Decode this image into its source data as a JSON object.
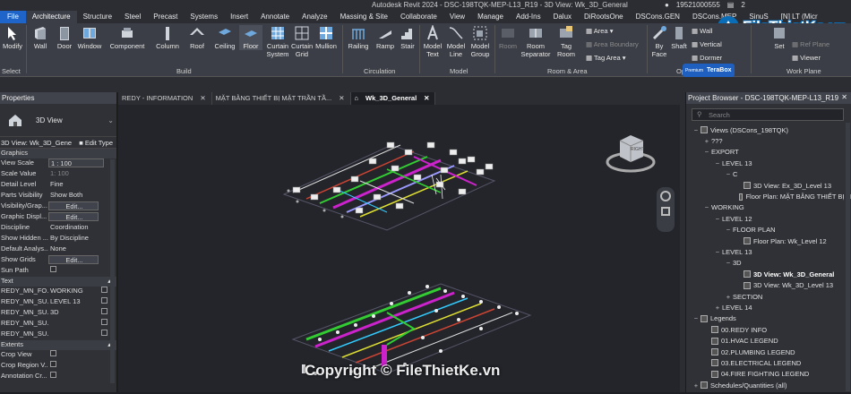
{
  "window": {
    "title": "Autodesk Revit 2024 - DSC-198TQK-MEP-L13_R19 - 3D View: Wk_3D_General",
    "user": "19521000555",
    "zoom_marker": "2"
  },
  "menu": [
    "File",
    "Architecture",
    "Structure",
    "Steel",
    "Precast",
    "Systems",
    "Insert",
    "Annotate",
    "Analyze",
    "Massing & Site",
    "Collaborate",
    "View",
    "Manage",
    "Add-Ins",
    "Dalux",
    "DiRootsOne",
    "DSCons.GEN",
    "DSCons.MEP",
    "SinuS",
    "[N] LT (Micr"
  ],
  "ribbon": {
    "buttons": [
      "Modify",
      "Wall",
      "Door",
      "Window",
      "Component",
      "Column",
      "Roof",
      "Ceiling",
      "Floor",
      "Curtain System",
      "Curtain Grid",
      "Mullion",
      "Railing",
      "Ramp",
      "Stair",
      "Model Text",
      "Model Line",
      "Model Group",
      "Room",
      "Room Separator",
      "Tag Room",
      "By Face",
      "Shaft",
      "Set",
      "Viewer"
    ],
    "small": {
      "area": "Area",
      "area_boundary": "Area Boundary",
      "tag_area": "Tag Area",
      "wall": "Wall",
      "vertical": "Vertical",
      "dormer": "Dormer",
      "ref_plane": "Ref Plane"
    },
    "groups": [
      "Select",
      "Build",
      "Circulation",
      "Model",
      "Room & Area",
      "Ope",
      "Work Plane"
    ],
    "terabox": "TeraBox",
    "premium": "Premium"
  },
  "properties": {
    "title": "Properties",
    "type_name": "3D View",
    "view_selector": "3D View: Wk_3D_Gene",
    "edit_type": "Edit Type",
    "sections": {
      "graphics": "Graphics",
      "text": "Text",
      "extents": "Extents"
    },
    "graphics_rows": [
      {
        "k": "View Scale",
        "v": "1 : 100",
        "style": "box"
      },
      {
        "k": "Scale Value",
        "v": "1: 100",
        "style": "dim"
      },
      {
        "k": "Detail Level",
        "v": "Fine",
        "style": ""
      },
      {
        "k": "Parts Visibility",
        "v": "Show Both",
        "style": ""
      },
      {
        "k": "Visibility/Grap...",
        "v": "Edit...",
        "style": "btn"
      },
      {
        "k": "Graphic Displ...",
        "v": "Edit...",
        "style": "btn"
      },
      {
        "k": "Discipline",
        "v": "Coordination",
        "style": ""
      },
      {
        "k": "Show Hidden ...",
        "v": "By Discipline",
        "style": ""
      },
      {
        "k": "Default Analys...",
        "v": "None",
        "style": ""
      },
      {
        "k": "Show Grids",
        "v": "Edit...",
        "style": "btn"
      },
      {
        "k": "Sun Path",
        "v": "",
        "style": "check"
      }
    ],
    "text_rows": [
      {
        "k": "REDY_MN_FO...",
        "v": "WORKING"
      },
      {
        "k": "REDY_MN_SU...",
        "v": "LEVEL 13"
      },
      {
        "k": "REDY_MN_SU...",
        "v": "3D"
      },
      {
        "k": "REDY_MN_SU...",
        "v": ""
      },
      {
        "k": "REDY_MN_SU...",
        "v": ""
      }
    ],
    "extents_rows": [
      {
        "k": "Crop View"
      },
      {
        "k": "Crop Region V..."
      },
      {
        "k": "Annotation Cr..."
      }
    ]
  },
  "doc_tabs": [
    "REDY - INFORMATION",
    "MẶT BẰNG THIẾT BỊ MẶT TRẦN TẦ...",
    "Wk_3D_General"
  ],
  "browser": {
    "title": "Project Browser - DSC-198TQK-MEP-L13_R19",
    "search": "Search",
    "items": [
      {
        "t": "Views (DSCons_198TQK)",
        "x": "−",
        "lvl": 0,
        "icon": true
      },
      {
        "t": "???",
        "x": "+",
        "lvl": 1
      },
      {
        "t": "EXPORT",
        "x": "−",
        "lvl": 1
      },
      {
        "t": "LEVEL 13",
        "x": "−",
        "lvl": 2
      },
      {
        "t": "C",
        "x": "−",
        "lvl": 3
      },
      {
        "t": "3D View: Ex_3D_Level 13",
        "x": "",
        "lvl": 4,
        "icon": true
      },
      {
        "t": "Floor Plan: MẶT BẰNG THIẾT BỊ N",
        "x": "",
        "lvl": 4,
        "icon": true
      },
      {
        "t": "WORKING",
        "x": "−",
        "lvl": 1
      },
      {
        "t": "LEVEL 12",
        "x": "−",
        "lvl": 2
      },
      {
        "t": "FLOOR PLAN",
        "x": "−",
        "lvl": 3
      },
      {
        "t": "Floor Plan: Wk_Level 12",
        "x": "",
        "lvl": 4,
        "icon": true
      },
      {
        "t": "LEVEL 13",
        "x": "−",
        "lvl": 2
      },
      {
        "t": "3D",
        "x": "−",
        "lvl": 3
      },
      {
        "t": "3D View: Wk_3D_General",
        "x": "",
        "lvl": 4,
        "icon": true,
        "sel": true
      },
      {
        "t": "3D View: Wk_3D_Level 13",
        "x": "",
        "lvl": 4,
        "icon": true
      },
      {
        "t": "SECTION",
        "x": "+",
        "lvl": 3
      },
      {
        "t": "LEVEL 14",
        "x": "+",
        "lvl": 2
      },
      {
        "t": "Legends",
        "x": "−",
        "lvl": 0,
        "icon": true
      },
      {
        "t": "00.REDY INFO",
        "x": "",
        "lvl": 1,
        "icon": true
      },
      {
        "t": "01.HVAC LEGEND",
        "x": "",
        "lvl": 1,
        "icon": true
      },
      {
        "t": "02.PLUMBING LEGEND",
        "x": "",
        "lvl": 1,
        "icon": true
      },
      {
        "t": "03.ELECTRICAL LEGEND",
        "x": "",
        "lvl": 1,
        "icon": true
      },
      {
        "t": "04.FIRE FIGHTING LEGEND",
        "x": "",
        "lvl": 1,
        "icon": true
      },
      {
        "t": "Schedules/Quantities (all)",
        "x": "+",
        "lvl": 0,
        "icon": true
      }
    ]
  },
  "viewcube": {
    "label": "RIGHT"
  },
  "watermark": "Copyright © FileThietKe.vn",
  "logo": "FileThietKe.vn",
  "colors": {
    "accent": "#1f64c9",
    "ribbon": "#3b3e46",
    "canvas": "#23252b"
  }
}
